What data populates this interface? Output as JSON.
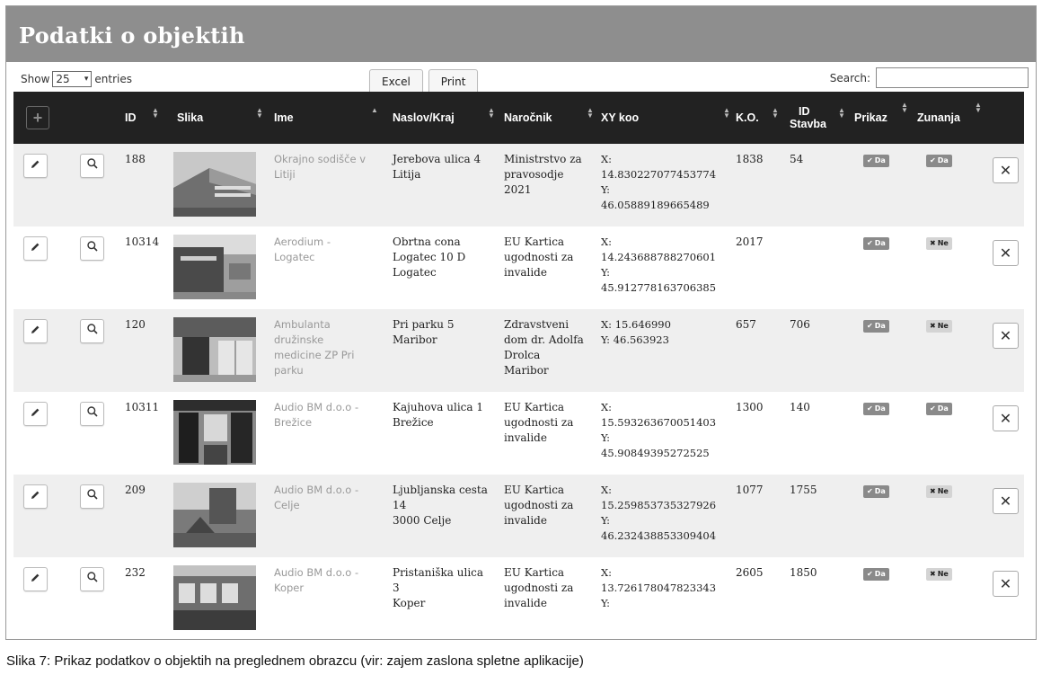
{
  "title": "Podatki o objektih",
  "controls": {
    "show_label": "Show",
    "entries_value": "25",
    "entries_label": "entries",
    "excel_label": "Excel",
    "print_label": "Print",
    "search_label": "Search:",
    "search_value": ""
  },
  "table": {
    "add_symbol": "+",
    "columns": {
      "id": "ID",
      "slika": "Slika",
      "ime": "Ime",
      "naslov": "Naslov/Kraj",
      "narocnik": "Naročnik",
      "xy": "XY koo",
      "ko": "K.O.",
      "id_stavba_1": "ID",
      "id_stavba_2": "Stavba",
      "prikaz": "Prikaz",
      "zunanja": "Zunanja"
    },
    "badge_yes": "Da",
    "badge_no": "Ne",
    "delete_symbol": "✕",
    "rows": [
      {
        "id": "188",
        "ime": [
          "Okrajno sodišče v",
          "Litiji"
        ],
        "naslov": [
          "Jerebova ulica 4",
          "Litija"
        ],
        "narocnik": [
          "Ministrstvo za",
          "pravosodje",
          "2021"
        ],
        "xy": [
          "X:",
          "14.830227077453774",
          "Y:",
          "46.05889189665489"
        ],
        "ko": "1838",
        "stavba": "54",
        "prikaz": "Da",
        "zunanja": "Da"
      },
      {
        "id": "10314",
        "ime": [
          "Aerodium -",
          "Logatec"
        ],
        "naslov": [
          "Obrtna cona",
          "Logatec 10 D",
          "Logatec"
        ],
        "narocnik": [
          "EU Kartica",
          "ugodnosti za",
          "invalide"
        ],
        "xy": [
          "X:",
          "14.243688788270601",
          "Y:",
          "45.912778163706385"
        ],
        "ko": "2017",
        "stavba": "",
        "prikaz": "Da",
        "zunanja": "Ne"
      },
      {
        "id": "120",
        "ime": [
          "Ambulanta",
          "družinske",
          "medicine ZP Pri",
          "parku"
        ],
        "naslov": [
          "Pri parku 5",
          "Maribor"
        ],
        "narocnik": [
          "Zdravstveni",
          "dom dr. Adolfa",
          "Drolca",
          "Maribor"
        ],
        "xy": [
          "X: 15.646990",
          "Y: 46.563923"
        ],
        "ko": "657",
        "stavba": "706",
        "prikaz": "Da",
        "zunanja": "Ne"
      },
      {
        "id": "10311",
        "ime": [
          "Audio BM d.o.o -",
          "Brežice"
        ],
        "naslov": [
          "Kajuhova ulica 1",
          "Brežice"
        ],
        "narocnik": [
          "EU Kartica",
          "ugodnosti za",
          "invalide"
        ],
        "xy": [
          "X:",
          "15.593263670051403",
          "Y:",
          "45.90849395272525"
        ],
        "ko": "1300",
        "stavba": "140",
        "prikaz": "Da",
        "zunanja": "Da"
      },
      {
        "id": "209",
        "ime": [
          "Audio BM d.o.o -",
          "Celje"
        ],
        "naslov": [
          "Ljubljanska cesta",
          "14",
          "3000 Celje"
        ],
        "narocnik": [
          "EU Kartica",
          "ugodnosti za",
          "invalide"
        ],
        "xy": [
          "X:",
          "15.259853735327926",
          "Y:",
          "46.232438853309404"
        ],
        "ko": "1077",
        "stavba": "1755",
        "prikaz": "Da",
        "zunanja": "Ne"
      },
      {
        "id": "232",
        "ime": [
          "Audio BM d.o.o -",
          "Koper"
        ],
        "naslov": [
          "Pristaniška ulica",
          "3",
          "Koper"
        ],
        "narocnik": [
          "EU Kartica",
          "ugodnosti za",
          "invalide"
        ],
        "xy": [
          "X:",
          "13.726178047823343",
          "Y:"
        ],
        "ko": "2605",
        "stavba": "1850",
        "prikaz": "Da",
        "zunanja": "Ne"
      }
    ]
  },
  "caption": "Slika 7: Prikaz podatkov o objektih na preglednem obrazcu (vir: zajem zaslona spletne aplikacije)",
  "colors": {
    "header_bar": "#8e8e8e",
    "table_head": "#222222",
    "row_alt": "#efefef",
    "badge_yes": "#8a8a8a",
    "badge_no": "#d4d4d4"
  },
  "icons": {
    "add": "plus-icon",
    "edit": "pencil-icon",
    "view": "magnifier-icon",
    "delete": "close-icon",
    "sort": "sort-arrows-icon"
  }
}
